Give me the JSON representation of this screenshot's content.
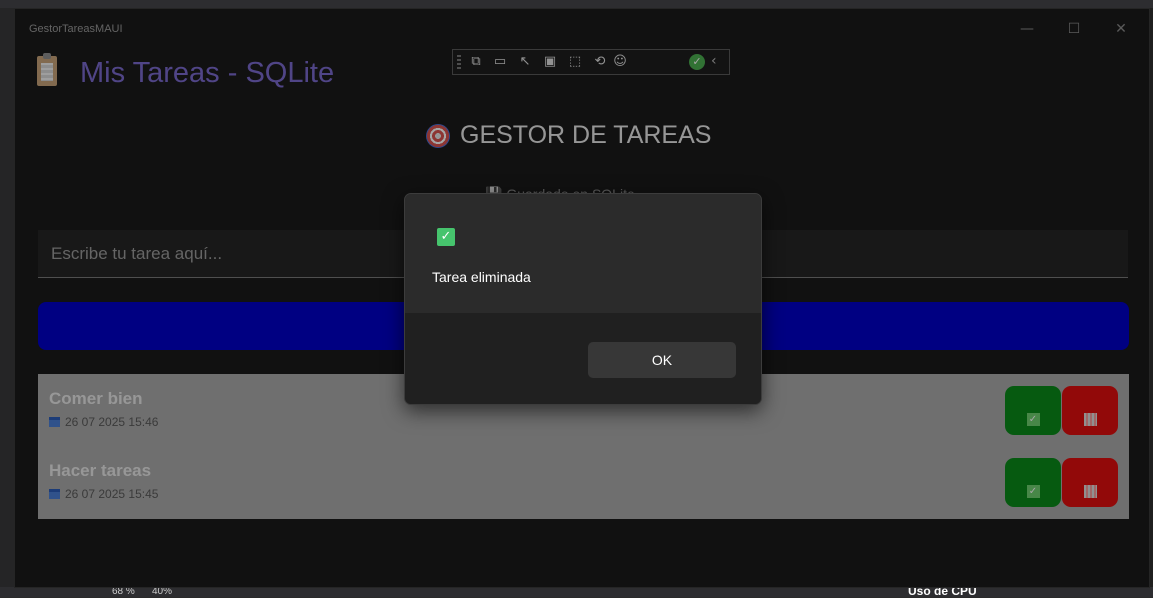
{
  "window": {
    "app_name": "GestorTareasMAUI",
    "minimize": "—",
    "maximize": "☐",
    "close": "✕"
  },
  "page": {
    "title": "Mis Tareas - SQLite"
  },
  "header": {
    "title": "GESTOR DE TAREAS",
    "subtitle": "💾 Guardado en SQLite"
  },
  "input": {
    "placeholder": "Escribe tu tarea aquí..."
  },
  "tasks": [
    {
      "title": "Comer bien",
      "date": "26 07 2025 15:46"
    },
    {
      "title": "Hacer tareas",
      "date": "26 07 2025 15:45"
    }
  ],
  "dialog": {
    "message": "Tarea eliminada",
    "ok_label": "OK"
  },
  "ide": {
    "zoom1": "68 %",
    "zoom2": "40%",
    "cpu_label": "Uso de CPU"
  },
  "colors": {
    "accent": "#7c6bcf",
    "add_button": "#0000c8",
    "done": "#0a8a1a",
    "delete": "#e00e0e"
  }
}
